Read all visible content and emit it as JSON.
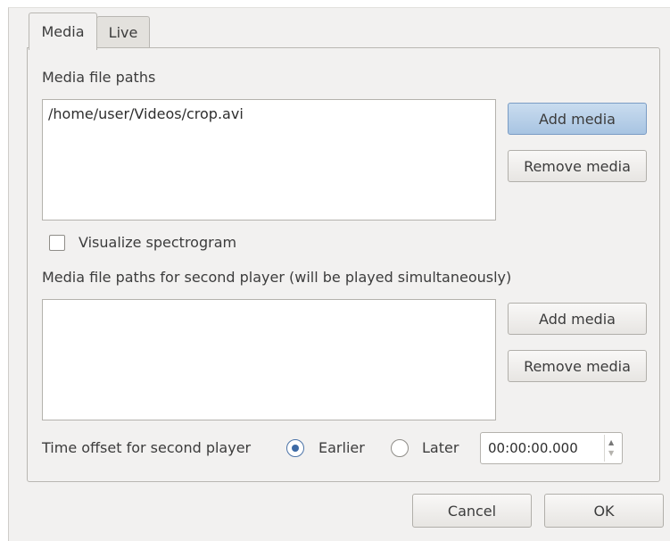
{
  "tabs": [
    {
      "label": "Media",
      "active": true
    },
    {
      "label": "Live",
      "active": false
    }
  ],
  "media": {
    "paths_label": "Media file paths",
    "paths": [
      "/home/user/Videos/crop.avi"
    ],
    "add_label": "Add media",
    "remove_label": "Remove media",
    "visualize_label": "Visualize spectrogram",
    "visualize_checked": false,
    "second_label": "Media file paths for second player (will be played simultaneously)",
    "second_paths": [],
    "second_add_label": "Add media",
    "second_remove_label": "Remove media",
    "offset_label": "Time offset for second player",
    "earlier_label": "Earlier",
    "later_label": "Later",
    "offset_value": "00:00:00.000",
    "selected_offset": "Earlier"
  },
  "footer": {
    "cancel_label": "Cancel",
    "ok_label": "OK"
  },
  "icons": {
    "spin_up": "chevron-up-icon",
    "spin_down": "chevron-down-icon"
  },
  "colors": {
    "focus_button": "#a8c4e2",
    "radio_selected": "#3d6aa5",
    "window_bg": "#f2f1f0"
  }
}
